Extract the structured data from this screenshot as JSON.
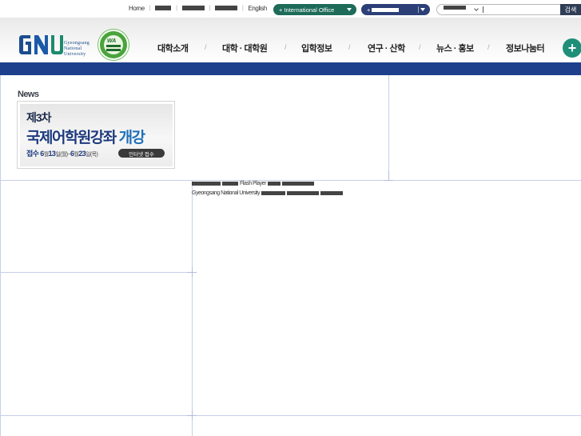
{
  "utility": {
    "links": [
      "Home",
      "■■■",
      "■■■■",
      "■■■■",
      "English"
    ],
    "international_office": "+ International Office",
    "related_sites": "+■■■■■■",
    "search_scope": "■■■■",
    "search_button": "검색"
  },
  "brand": {
    "name_line1": "Gyeongsang",
    "name_line2": "National",
    "name_line3": "University",
    "seal_text": "WA"
  },
  "nav": {
    "items": [
      "대학소개",
      "대학 · 대학원",
      "입학정보",
      "연구 · 산학",
      "뉴스 · 홍보",
      "정보나눔터"
    ],
    "more_button": "+"
  },
  "news": {
    "title": "News",
    "banner": {
      "line1": "제3차",
      "line2_a": "국제어학원강좌",
      "line2_b": "개강",
      "line3_a": "접수",
      "line3_b": "6",
      "line3_c": "월",
      "line3_d": "13",
      "line3_e": "일(월)~",
      "line3_f": "6",
      "line3_g": "월",
      "line3_h": "23",
      "line3_i": "일(목)",
      "button": "인터넷 접수"
    }
  },
  "flash_notice": {
    "line1": "Flash Player",
    "line2": "Gyeongsang National University"
  },
  "colors": {
    "navbar": "#1e3f8c",
    "brand_green": "#1e8f78",
    "international_pill": "#1e6b5a",
    "sites_pill": "#2c3f77"
  }
}
